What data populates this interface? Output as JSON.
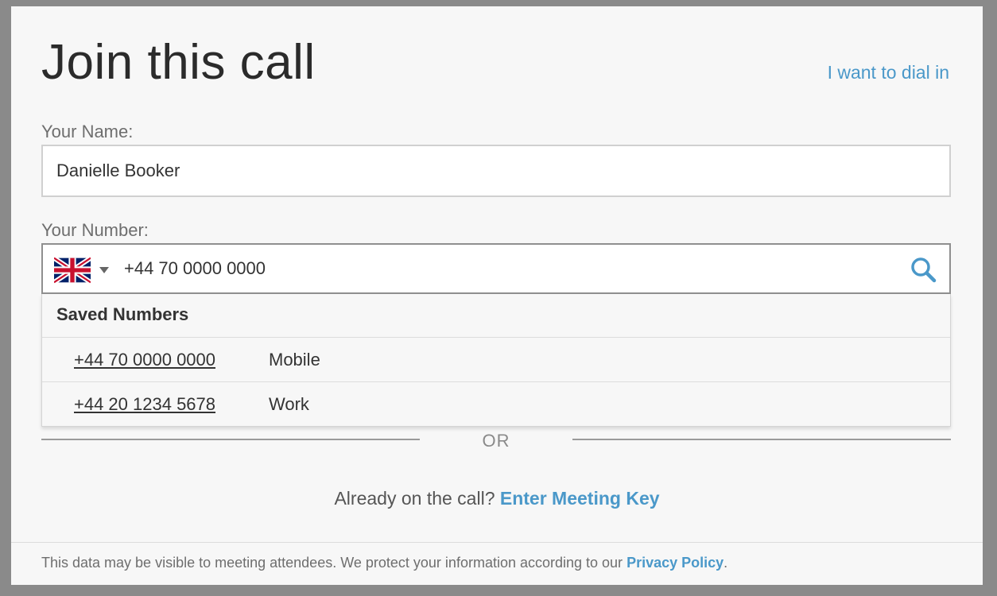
{
  "modal": {
    "title": "Join this call",
    "dial_in_link": "I want to dial in"
  },
  "name_field": {
    "label": "Your Name:",
    "value": "Danielle Booker"
  },
  "number_field": {
    "label": "Your Number:",
    "country_flag": "united-kingdom-flag-icon",
    "value": "+44 70 0000 0000",
    "search_icon": "search-icon"
  },
  "saved_numbers": {
    "header": "Saved Numbers",
    "items": [
      {
        "number": "+44 70 0000 0000",
        "type": "Mobile"
      },
      {
        "number": "+44 20 1234 5678",
        "type": "Work"
      }
    ]
  },
  "divider": {
    "text": "OR"
  },
  "meeting_key": {
    "prompt": "Already on the call? ",
    "link": "Enter Meeting Key"
  },
  "footer": {
    "text": "This data may be visible to meeting attendees. We protect your information according to our ",
    "link": "Privacy Policy",
    "suffix": "."
  },
  "colors": {
    "accent": "#4a98c9",
    "background": "#f7f7f7",
    "overlay": "#8a8a8a"
  }
}
